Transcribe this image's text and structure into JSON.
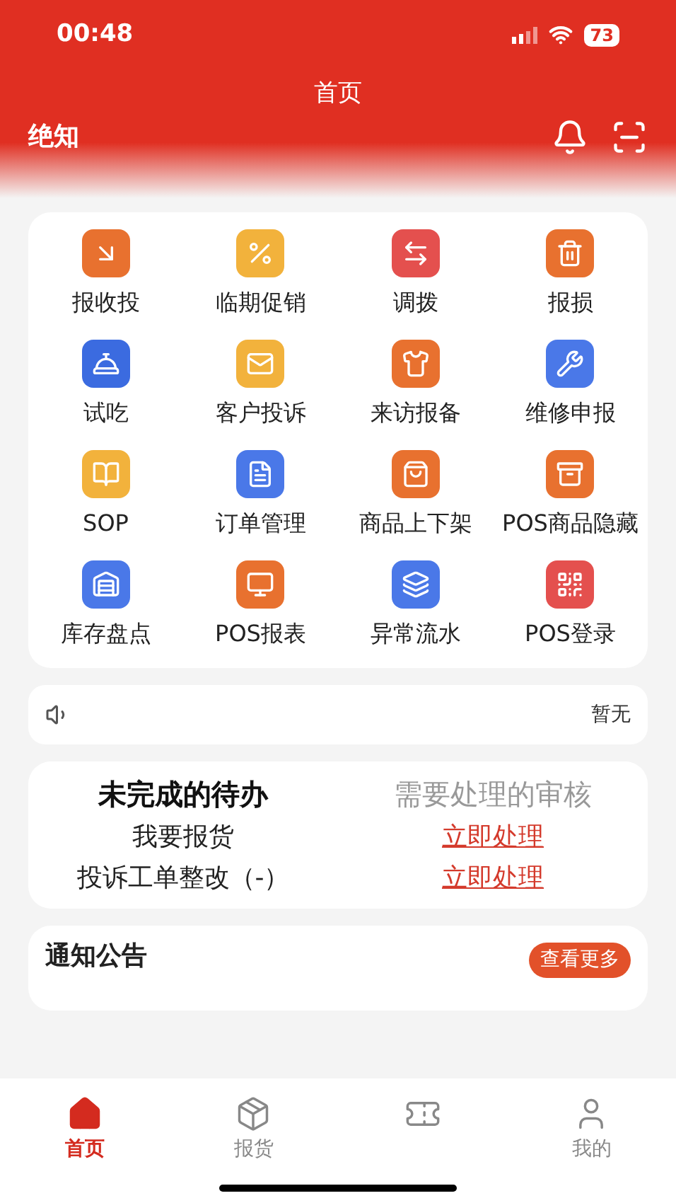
{
  "status_bar": {
    "time": "00:48",
    "battery": "73"
  },
  "header": {
    "title": "首页",
    "store": "绝知"
  },
  "grid": [
    {
      "label": "报收投"
    },
    {
      "label": "临期促销"
    },
    {
      "label": "调拨"
    },
    {
      "label": "报损"
    },
    {
      "label": "试吃"
    },
    {
      "label": "客户投诉"
    },
    {
      "label": "来访报备"
    },
    {
      "label": "维修申报"
    },
    {
      "label": "SOP"
    },
    {
      "label": "订单管理"
    },
    {
      "label": "商品上下架"
    },
    {
      "label": "POS商品隐藏"
    },
    {
      "label": "库存盘点"
    },
    {
      "label": "POS报表"
    },
    {
      "label": "异常流水"
    },
    {
      "label": "POS登录"
    }
  ],
  "marquee": {
    "text": "暂无"
  },
  "todo": {
    "tabs": [
      {
        "label": "未完成的待办",
        "selected": true
      },
      {
        "label": "需要处理的审核",
        "selected": false
      }
    ],
    "rows": [
      {
        "name": "我要报货",
        "action": "立即处理"
      },
      {
        "name": "投诉工单整改（-）",
        "action": "立即处理"
      }
    ]
  },
  "notices": {
    "title": "通知公告",
    "more": "查看更多"
  },
  "tab_bar": [
    {
      "label": "首页",
      "selected": true
    },
    {
      "label": "报货",
      "selected": false
    },
    {
      "selected": false
    },
    {
      "label": "我的",
      "selected": false
    }
  ]
}
